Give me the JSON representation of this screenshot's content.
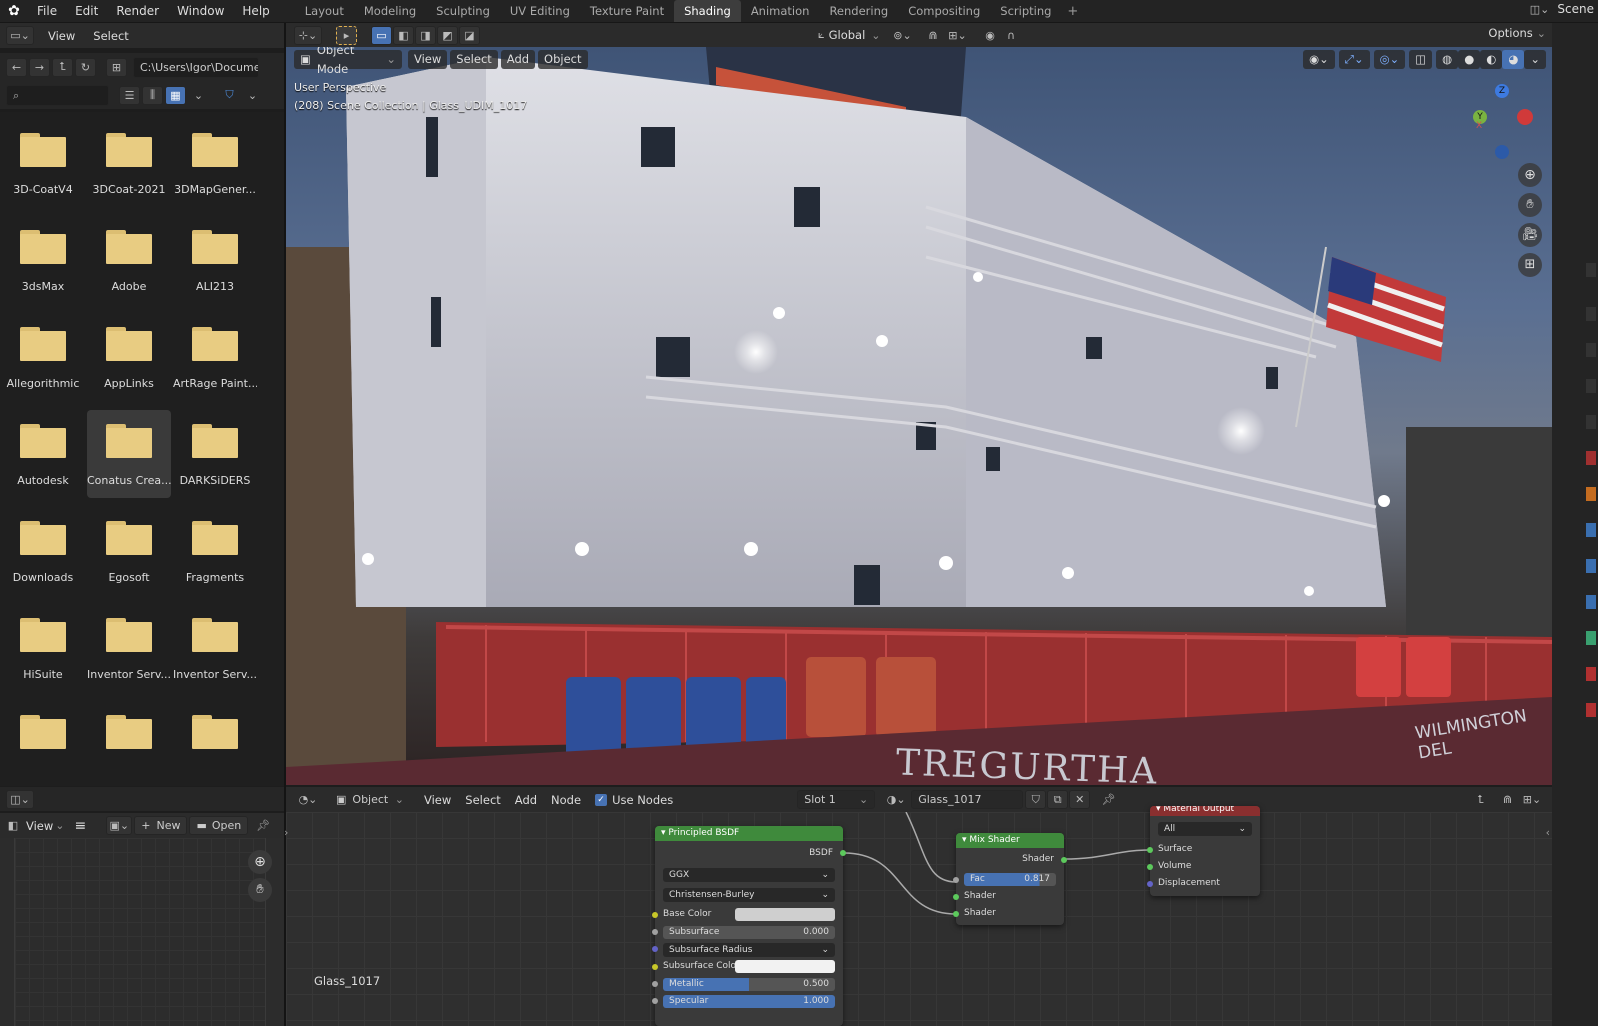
{
  "menu": [
    "File",
    "Edit",
    "Render",
    "Window",
    "Help"
  ],
  "workspaces": [
    "Layout",
    "Modeling",
    "Sculpting",
    "UV Editing",
    "Texture Paint",
    "Shading",
    "Animation",
    "Rendering",
    "Compositing",
    "Scripting"
  ],
  "active_workspace": "Shading",
  "add_tab": "+",
  "scene": {
    "label": "Scene"
  },
  "filebrowser": {
    "view": "View",
    "select": "Select",
    "path": "C:\\Users\\Igor\\Docume...",
    "search_placeholder": "",
    "folders": [
      "3D-CoatV4",
      "3DCoat-2021",
      "3DMapGener...",
      "3dsMax",
      "Adobe",
      "ALI213",
      "Allegorithmic",
      "AppLinks",
      "ArtRage Paint...",
      "Autodesk",
      "Conatus Crea...",
      "DARKSiDERS",
      "Downloads",
      "Egosoft",
      "Fragments",
      "HiSuite",
      "Inventor Serv...",
      "Inventor Serv...",
      "",
      "",
      ""
    ],
    "selected": "Conatus Crea..."
  },
  "viewport": {
    "mode": "Object Mode",
    "view": "View",
    "select": "Select",
    "add": "Add",
    "object": "Object",
    "perspective": "User Perspective",
    "collection": "(208) Scene Collection | Glass_UDIM_1017",
    "transform": "Global",
    "options": "Options",
    "ship_text_1": "WILMINGTON DEL",
    "ship_text_2": "TREGURTHA",
    "axes": {
      "z": "Z",
      "y": "Y",
      "x": "X"
    }
  },
  "image_editor": {
    "view": "View",
    "new": "New",
    "open": "Open"
  },
  "node_editor": {
    "object": "Object",
    "view": "View",
    "select": "Select",
    "add": "Add",
    "node": "Node",
    "use_nodes": "Use Nodes",
    "slot": "Slot 1",
    "material": "Glass_1017",
    "label": "Glass_1017",
    "principled": {
      "title": "Principled BSDF",
      "out": "BSDF",
      "dist": "GGX",
      "sss": "Christensen-Burley",
      "base_color": "Base Color",
      "subsurface": "Subsurface",
      "subsurface_val": "0.000",
      "sss_radius": "Subsurface Radius",
      "sss_color": "Subsurface Colo",
      "metallic": "Metallic",
      "metallic_val": "0.500",
      "specular": "Specular",
      "specular_val": "1.000"
    },
    "mix": {
      "title": "Mix Shader",
      "out": "Shader",
      "fac": "Fac",
      "fac_val": "0.817",
      "in1": "Shader",
      "in2": "Shader"
    },
    "output": {
      "title": "Material Output",
      "target": "All",
      "surface": "Surface",
      "volume": "Volume",
      "displacement": "Displacement"
    }
  },
  "colors": {
    "accent": "#4772b3",
    "node_green": "#3f8a3c",
    "node_red": "#8a2f2f",
    "folder": "#e8cc82"
  }
}
